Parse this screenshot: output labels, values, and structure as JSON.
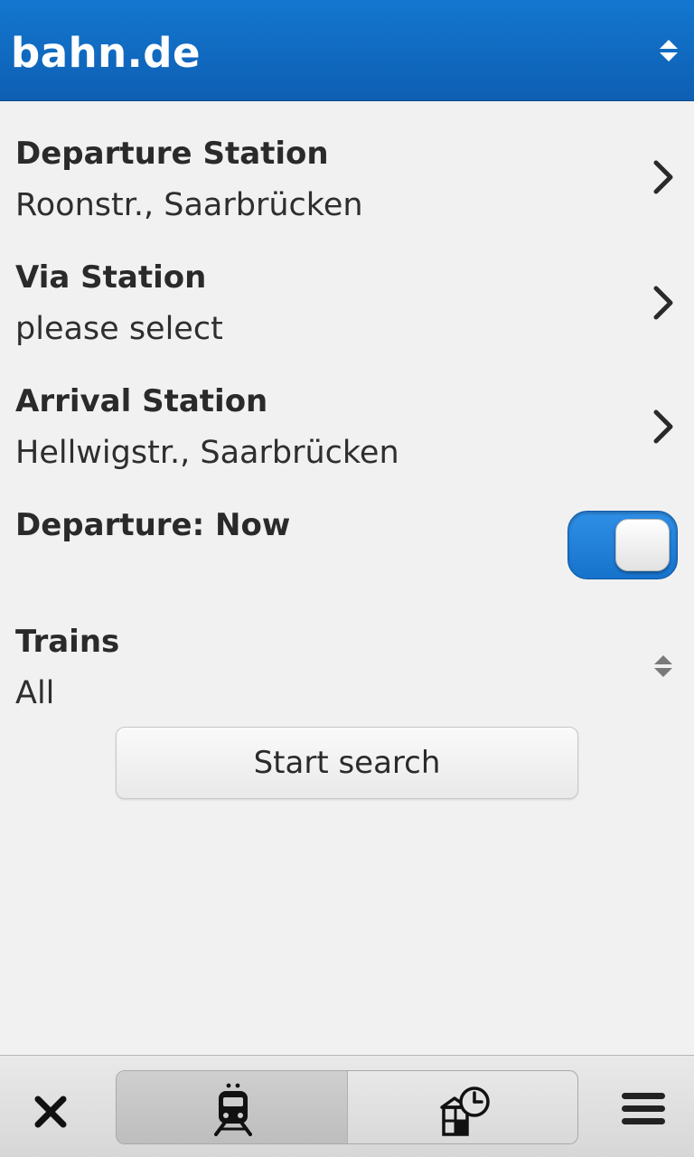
{
  "header": {
    "title": "bahn.de",
    "sort_icon": "sort-updown-icon"
  },
  "form": {
    "departure": {
      "label": "Departure Station",
      "value": "Roonstr., Saarbrücken",
      "icon": "chevron-right-icon"
    },
    "via": {
      "label": "Via Station",
      "value": "please select",
      "icon": "chevron-right-icon"
    },
    "arrival": {
      "label": "Arrival Station",
      "value": "Hellwigstr., Saarbrücken",
      "icon": "chevron-right-icon"
    },
    "departure_time": {
      "label": "Departure: Now",
      "toggle_on": true
    },
    "trains": {
      "label": "Trains",
      "value": "All",
      "icon": "updown-icon"
    },
    "search_button": "Start search"
  },
  "toolbar": {
    "close_icon": "close-icon",
    "tabs": [
      {
        "icon": "train-icon",
        "selected": true
      },
      {
        "icon": "station-clock-icon",
        "selected": false
      }
    ],
    "menu_icon": "menu-icon"
  },
  "colors": {
    "header_blue": "#0d5fb3",
    "toggle_blue": "#1c7fd8",
    "background": "#f1f1f1"
  }
}
